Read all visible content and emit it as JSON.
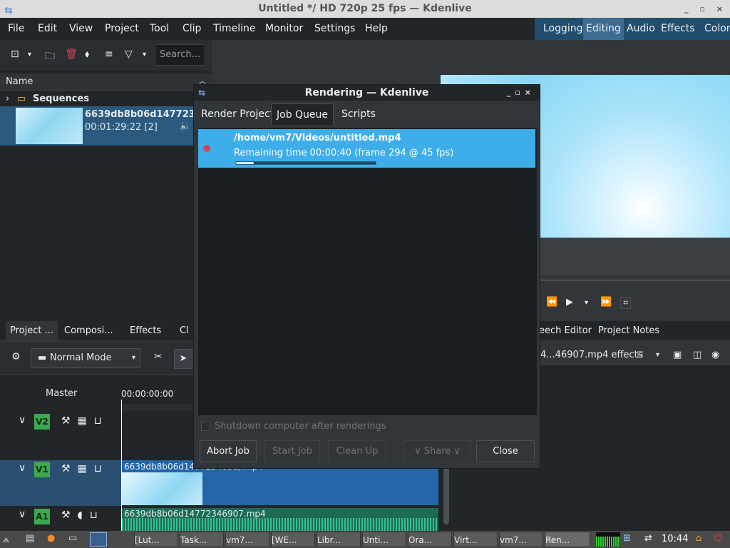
{
  "window": {
    "title": "Untitled */ HD 720p 25 fps — Kdenlive",
    "controls": [
      "_",
      "▫",
      "×"
    ]
  },
  "menu": {
    "items": [
      "File",
      "Edit",
      "View",
      "Project",
      "Tool",
      "Clip",
      "Timeline",
      "Monitor",
      "Settings",
      "Help"
    ],
    "layouts": [
      "Logging",
      "Editing",
      "Audio",
      "Effects",
      "Color"
    ],
    "active_layout": "Editing"
  },
  "bin": {
    "search_placeholder": "Search...",
    "column_name": "Name",
    "sequences_label": "Sequences",
    "clip": {
      "name": "6639db8b06d147723469",
      "duration": "00:01:29:22 [2]"
    }
  },
  "left_tabs": [
    "Project ...",
    "Composi...",
    "Effects",
    "Cl"
  ],
  "right_tabs": [
    "eech Editor",
    "Project Notes"
  ],
  "effects_row": "4...46907.mp4 effects",
  "timeline": {
    "mode": "Normal Mode",
    "master_label": "Master",
    "timecode": "00:00:00:00",
    "tracks": [
      {
        "label": "V2"
      },
      {
        "label": "V1"
      },
      {
        "label": "A1"
      }
    ],
    "v1_clip_name": "6639db8b06d1477234690/.mp4",
    "a1_clip_name": "6639db8b06d14772346907.mp4"
  },
  "dialog": {
    "title": "Rendering — Kdenlive",
    "tabs": [
      "Render Project",
      "Job Queue",
      "Scripts"
    ],
    "active_tab": "Job Queue",
    "job": {
      "path": "/home/vm7/Videos/untitled.mp4",
      "status": "Remaining time 00:00:40 (frame 294 @ 45 fps)",
      "progress": 0.13
    },
    "shutdown_label": "Shutdown computer after renderings",
    "buttons": {
      "abort": "Abort Job",
      "start": "Start Job",
      "cleanup": "Clean Up",
      "share": "Share",
      "close": "Close"
    }
  },
  "taskbar": {
    "tasks": [
      "[Lut...",
      "Task...",
      "vm7...",
      "[WE...",
      "Libr...",
      "Unti...",
      "Ora...",
      "Virt...",
      "vm7...",
      "Ren..."
    ],
    "clock": "10:44"
  },
  "colors": {
    "accent": "#3daee9",
    "track_green": "#3ea84e",
    "v1_clip": "#2266a8",
    "a1_clip": "#1e6a56",
    "record_dot": "#da4453"
  }
}
